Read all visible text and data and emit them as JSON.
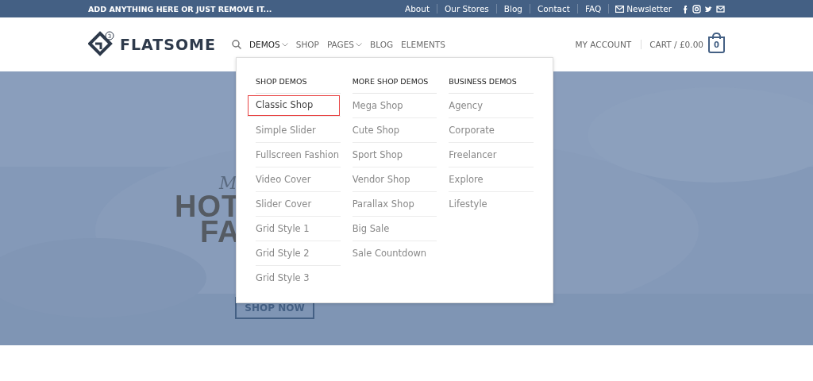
{
  "top_bar": {
    "message": "ADD ANYTHING HERE OR JUST REMOVE IT...",
    "links": [
      "About",
      "Our Stores",
      "Blog",
      "Contact",
      "FAQ"
    ],
    "newsletter": "Newsletter"
  },
  "header": {
    "logo": "FLATSOME",
    "logo_badge": "3",
    "nav": [
      {
        "label": "DEMOS",
        "dropdown": true,
        "selected": true
      },
      {
        "label": "SHOP",
        "dropdown": false,
        "selected": false
      },
      {
        "label": "PAGES",
        "dropdown": true,
        "selected": false
      },
      {
        "label": "BLOG",
        "dropdown": false,
        "selected": false
      },
      {
        "label": "ELEMENTS",
        "dropdown": false,
        "selected": false
      }
    ],
    "account": "MY ACCOUNT",
    "cart": "CART / £0.00",
    "cart_count": "0"
  },
  "mega_menu": {
    "columns": [
      {
        "title": "SHOP DEMOS",
        "items": [
          {
            "label": "Classic Shop",
            "selected": true
          },
          {
            "label": "Simple Slider",
            "selected": false
          },
          {
            "label": "Fullscreen Fashion",
            "selected": false
          },
          {
            "label": "Video Cover",
            "selected": false
          },
          {
            "label": "Slider Cover",
            "selected": false
          },
          {
            "label": "Grid Style 1",
            "selected": false
          },
          {
            "label": "Grid Style 2",
            "selected": false
          },
          {
            "label": "Grid Style 3",
            "selected": false
          }
        ]
      },
      {
        "title": "MORE SHOP DEMOS",
        "items": [
          {
            "label": "Mega Shop",
            "selected": false
          },
          {
            "label": "Cute Shop",
            "selected": false
          },
          {
            "label": "Sport Shop",
            "selected": false
          },
          {
            "label": "Vendor Shop",
            "selected": false
          },
          {
            "label": "Parallax Shop",
            "selected": false
          },
          {
            "label": "Big Sale",
            "selected": false
          },
          {
            "label": "Sale Countdown",
            "selected": false
          }
        ]
      },
      {
        "title": "BUSINESS DEMOS",
        "items": [
          {
            "label": "Agency",
            "selected": false
          },
          {
            "label": "Corporate",
            "selected": false
          },
          {
            "label": "Freelancer",
            "selected": false
          },
          {
            "label": "Explore",
            "selected": false
          },
          {
            "label": "Lifestyle",
            "selected": false
          }
        ]
      }
    ]
  },
  "hero": {
    "script_text": "M",
    "headline_1": "HOT",
    "headline_2": "FA",
    "button": "SHOP NOW"
  }
}
